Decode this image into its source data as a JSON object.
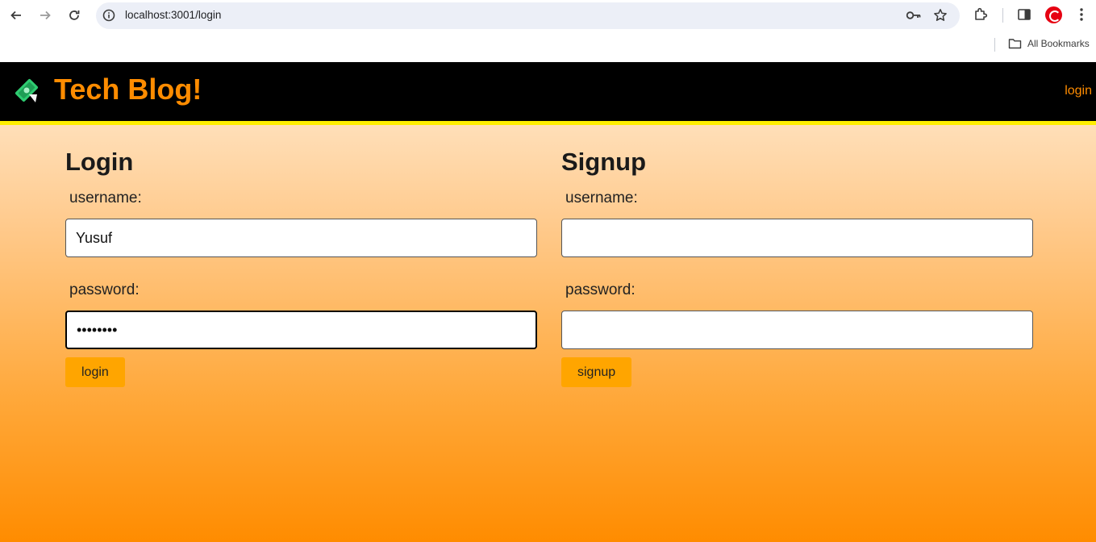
{
  "browser": {
    "url": "localhost:3001/login",
    "bookmarks_label": "All Bookmarks"
  },
  "header": {
    "title": "Tech Blog!",
    "nav_login": "login",
    "accent_color": "#ff8c00",
    "border_color": "#ffee00"
  },
  "login": {
    "heading": "Login",
    "username_label": "username:",
    "username_value": "Yusuf",
    "password_label": "password:",
    "password_value": "••••••••",
    "button_label": "login"
  },
  "signup": {
    "heading": "Signup",
    "username_label": "username:",
    "username_value": "",
    "password_label": "password:",
    "password_value": "",
    "button_label": "signup"
  },
  "colors": {
    "button": "#ffa500",
    "gradient_top": "#ffecd4",
    "gradient_bottom": "#ff8c00"
  }
}
